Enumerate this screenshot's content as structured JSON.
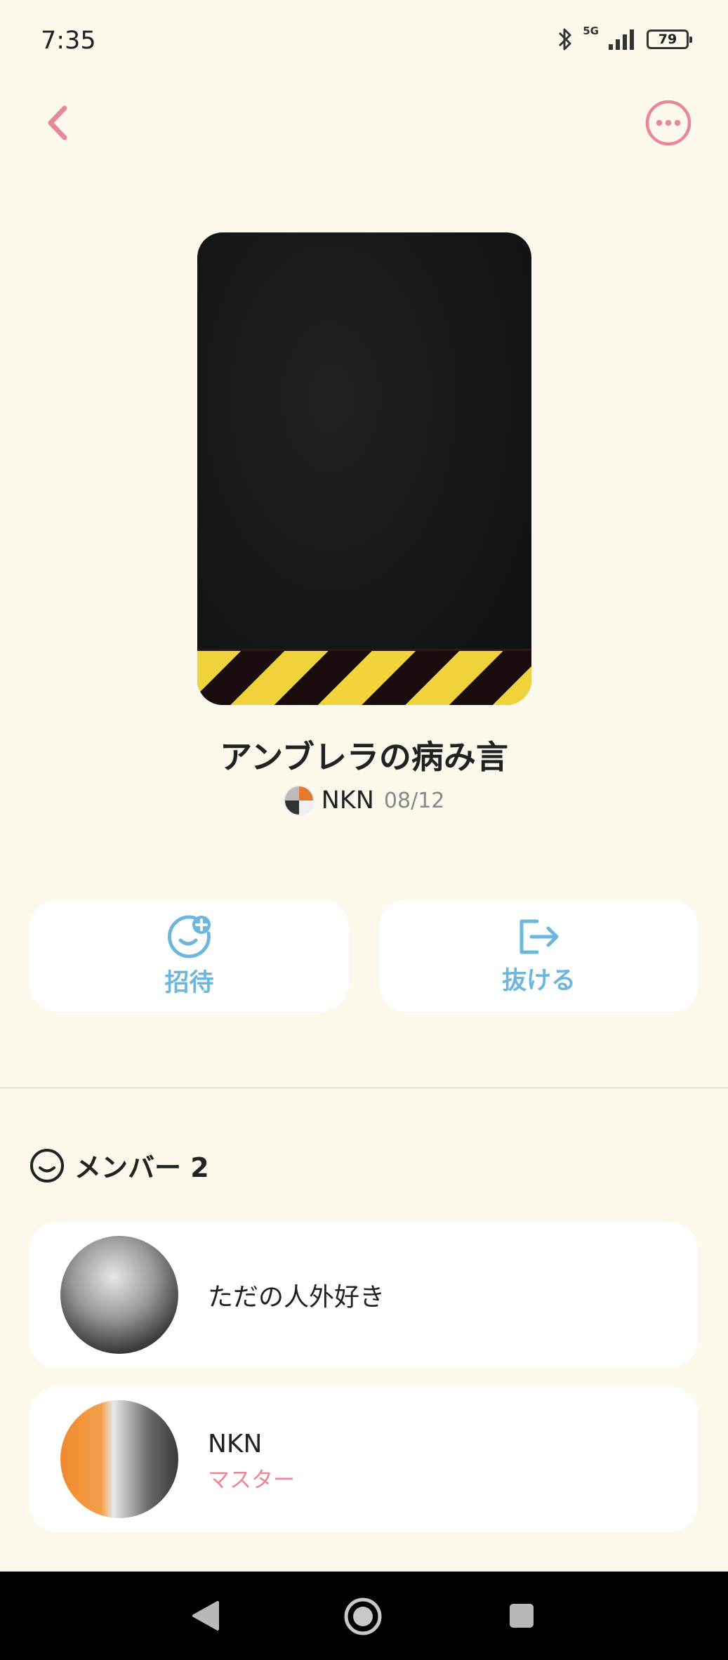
{
  "status_bar": {
    "time": "7:35",
    "network": "5G",
    "battery": "79",
    "icons": [
      "bluetooth-icon",
      "signal-icon",
      "battery-icon"
    ]
  },
  "header": {
    "back_icon": "chevron-left-icon",
    "more_icon": "more-horizontal-icon",
    "accent_color": "#e8879a"
  },
  "room": {
    "title": "アンブレラの病み言",
    "creator": "NKN",
    "date": "08/12"
  },
  "actions": {
    "invite_label": "招待",
    "leave_label": "抜ける",
    "icon_color": "#6db7de"
  },
  "members": {
    "title": "メンバー 2",
    "items": [
      {
        "name": "ただの人外好き",
        "role": ""
      },
      {
        "name": "NKN",
        "role": "マスター"
      }
    ]
  }
}
